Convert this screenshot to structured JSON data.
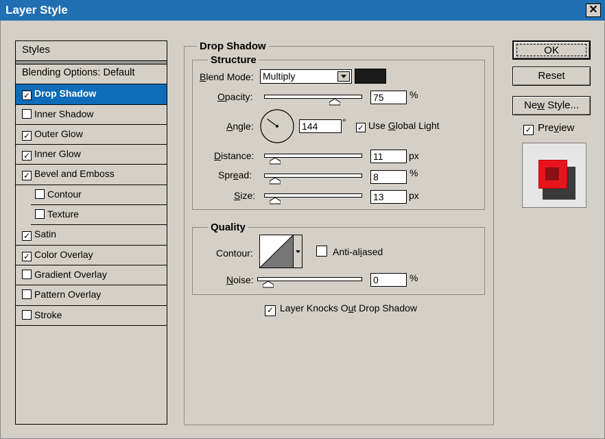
{
  "window": {
    "title": "Layer Style",
    "close_glyph": "✕"
  },
  "styles_panel": {
    "header": "Styles",
    "blending_options": "Blending Options: Default",
    "items": [
      {
        "label": "Drop Shadow",
        "checked": true,
        "selected": true,
        "sub": false
      },
      {
        "label": "Inner Shadow",
        "checked": false,
        "selected": false,
        "sub": false
      },
      {
        "label": "Outer Glow",
        "checked": true,
        "selected": false,
        "sub": false
      },
      {
        "label": "Inner Glow",
        "checked": true,
        "selected": false,
        "sub": false
      },
      {
        "label": "Bevel and Emboss",
        "checked": true,
        "selected": false,
        "sub": false
      },
      {
        "label": "Contour",
        "checked": false,
        "selected": false,
        "sub": true
      },
      {
        "label": "Texture",
        "checked": false,
        "selected": false,
        "sub": true
      },
      {
        "label": "Satin",
        "checked": true,
        "selected": false,
        "sub": false
      },
      {
        "label": "Color Overlay",
        "checked": true,
        "selected": false,
        "sub": false
      },
      {
        "label": "Gradient Overlay",
        "checked": false,
        "selected": false,
        "sub": false
      },
      {
        "label": "Pattern Overlay",
        "checked": false,
        "selected": false,
        "sub": false
      },
      {
        "label": "Stroke",
        "checked": false,
        "selected": false,
        "sub": false
      }
    ]
  },
  "drop_shadow": {
    "title": "Drop Shadow",
    "structure": {
      "title": "Structure",
      "blend_mode": {
        "label_u": "B",
        "label_rest": "lend Mode:",
        "value": "Multiply",
        "color": "#1a1a1a"
      },
      "opacity": {
        "label_u": "O",
        "label_rest": "pacity:",
        "value": "75",
        "unit": "%",
        "fraction": 0.75
      },
      "angle": {
        "label_pre": "",
        "label_u": "A",
        "label_rest": "ngle:",
        "value": "144",
        "unit": "°",
        "degrees": 144
      },
      "use_global_light": {
        "pre": "Use ",
        "u": "G",
        "rest": "lobal Light",
        "checked": true
      },
      "distance": {
        "label_u": "D",
        "label_rest": "istance:",
        "value": "11",
        "unit": "px",
        "fraction": 0.06
      },
      "spread": {
        "label_pre": "Spr",
        "label_u": "e",
        "label_rest": "ad:",
        "value": "8",
        "unit": "%",
        "fraction": 0.06
      },
      "size": {
        "label_u": "S",
        "label_rest": "ize:",
        "value": "13",
        "unit": "px",
        "fraction": 0.06
      }
    },
    "quality": {
      "title": "Quality",
      "contour_label": "Contour:",
      "anti_aliased": {
        "pre": "Anti-al",
        "u": "i",
        "rest": "ased",
        "checked": false
      },
      "noise": {
        "label_u": "N",
        "label_rest": "oise:",
        "value": "0",
        "unit": "%",
        "fraction": 0.0
      }
    },
    "knocks_out": {
      "pre": "Layer Knocks O",
      "u": "u",
      "rest": "t Drop Shadow",
      "checked": true
    }
  },
  "buttons": {
    "ok": "OK",
    "reset": "Reset",
    "new_style_pre": "Ne",
    "new_style_u": "w",
    "new_style_rest": " Style...",
    "preview_pre": "Pre",
    "preview_u": "v",
    "preview_rest": "iew",
    "preview_checked": true
  },
  "colors": {
    "titlebar": "#1f6fb2",
    "selection": "#0f6cb8",
    "dialog": "#d4d0c8",
    "preview_red": "#e8141c"
  }
}
